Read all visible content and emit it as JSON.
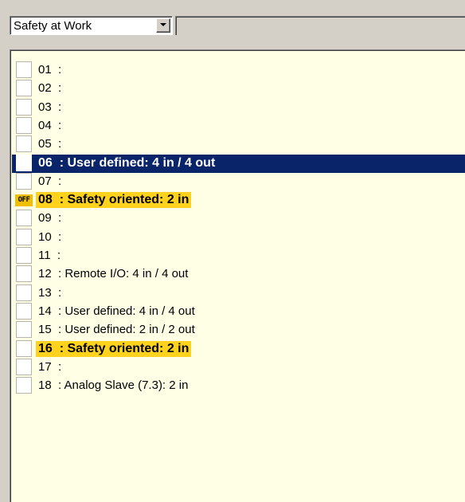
{
  "toolbar": {
    "dropdown_value": "Safety at Work",
    "filter_value": ""
  },
  "colors": {
    "panel_bg": "#ffffe6",
    "selection": "#0a246a",
    "highlight": "#ffd21e",
    "off_badge": "#f0c000"
  },
  "list": {
    "rows": [
      {
        "text": "01  :",
        "state": "normal",
        "badge": ""
      },
      {
        "text": "02  :",
        "state": "normal",
        "badge": ""
      },
      {
        "text": "03  :",
        "state": "normal",
        "badge": ""
      },
      {
        "text": "04  :",
        "state": "normal",
        "badge": ""
      },
      {
        "text": "05  :",
        "state": "normal",
        "badge": ""
      },
      {
        "text": "06  : User defined: 4 in / 4 out",
        "state": "selected",
        "badge": ""
      },
      {
        "text": "07  :",
        "state": "normal",
        "badge": ""
      },
      {
        "text": "08  : Safety oriented: 2 in",
        "state": "highlight",
        "badge": "OFF"
      },
      {
        "text": "09  :",
        "state": "normal",
        "badge": ""
      },
      {
        "text": "10  :",
        "state": "normal",
        "badge": ""
      },
      {
        "text": "11  :",
        "state": "normal",
        "badge": ""
      },
      {
        "text": "12  : Remote I/O: 4 in / 4 out",
        "state": "normal",
        "badge": ""
      },
      {
        "text": "13  :",
        "state": "normal",
        "badge": ""
      },
      {
        "text": "14  : User defined: 4 in / 4 out",
        "state": "normal",
        "badge": ""
      },
      {
        "text": "15  : User defined: 2 in / 2 out",
        "state": "normal",
        "badge": ""
      },
      {
        "text": "16  : Safety oriented: 2 in",
        "state": "highlight",
        "badge": ""
      },
      {
        "text": "17  :",
        "state": "normal",
        "badge": ""
      },
      {
        "text": "18  : Analog Slave (7.3): 2 in",
        "state": "normal",
        "badge": ""
      }
    ]
  }
}
